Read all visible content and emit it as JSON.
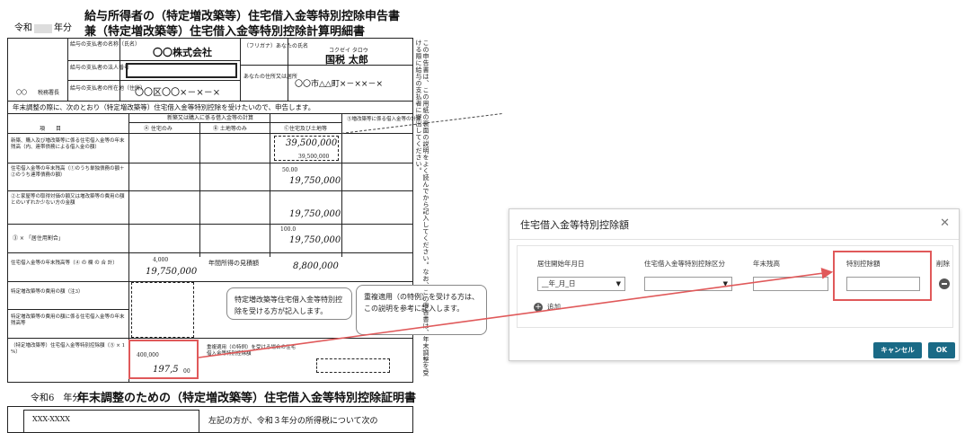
{
  "form": {
    "era_label": "令和",
    "era_suffix": "年分",
    "title1": "給与所得者の（特定増改築等）住宅借入金等特別控除申告書",
    "title2": "兼（特定増改築等）住宅借入金等特別控除計算明細書",
    "payer_name_label": "給与の支払者の名称（氏名）",
    "payer_name_value": "〇〇株式会社",
    "corp_number_label": "給与の支払者の法人番号",
    "payer_address_label": "給与の支払者の所在地（住所）",
    "payer_address_value": "〇〇区〇〇×－×－×",
    "tax_office": "〇〇　　税務署長",
    "furigana_label": "（フリガナ）あなたの氏名",
    "name_furigana": "コクゼイ タロウ",
    "name_value": "国税 太郎",
    "your_address_label": "あなたの住所又は居所",
    "your_address_value": "〇〇市△△町×－××－×",
    "intro": "年末調整の際に、次のとおり（特定増改築等）住宅借入金等特別控除を受けたいので、申告します。",
    "col_new_build": "新築又は購入に係る借入金等の計算",
    "col_house": "Ⓐ 住宅のみ",
    "col_land": "Ⓑ 土地等のみ",
    "col_both": "Ⓒ住宅及び土地等",
    "col_remodel": "⑤増改築等に係る借入金等の計算",
    "col_item": "項　　目",
    "row1_label": "新築、購入及び増改築等に係る住宅借入金等の年末残高（内、連帯債務による借入金の額）",
    "row1_value": "39,500,000",
    "row1_sub": "39,500,000",
    "row2_label": "住宅借入金等の年末残高（①のうち単独債務の額＋②のうち連帯債務の額）",
    "row2_pct": "50.00",
    "row2_value": "19,750,000",
    "row3_label": "②と家屋等の取得対価の額又は増改築等の費用の額とのいずれか少ない方の金額",
    "row3_value": "19,750,000",
    "row4_label": "③ × 「居住用割合」",
    "row4_pct": "100.0",
    "row4_value": "19,750,000",
    "row5_label": "住宅借入金等の年末残高等（④ の 欄 の 合 計）",
    "row5_max": "4,000",
    "row5_value": "19,750,000",
    "income_label": "年間所得の見積額",
    "income_value": "8,800,000",
    "row6_label": "特定増改築等の費用の額（注3）",
    "row7_label": "特定増改築等の費用の額に係る住宅借入金等の年末残高等",
    "row8_label": "（特定増改築等）住宅借入金等特別控除額（⑤ × 1 %）",
    "row8_max": "400,000",
    "row8_value": "197,5",
    "row8_yen": "00",
    "dup_label": "重複適用（の特例）を受ける場合の住宅借入金等特別控除額",
    "side_text": "この申告書は、この用紙の裏面の説明をよく読んでから記入してください。なお、この申告書は、年末調整を受ける際に給与の支払者に提出してください。",
    "callout1": "特定増改築等住宅借入金等特別控除を受ける方が記入します。",
    "callout2": "重複適用（の特例）を受ける方は、この説明を参考に記入します。",
    "cert_era": "令和6　年分",
    "cert_title": "年末調整のための（特定増改築等）住宅借入金等特別控除証明書",
    "cert_text": "左記の方が、令和３年分の所得税について次の",
    "cert_id": "XXX-XXXX"
  },
  "dialog": {
    "title": "住宅借入金等特別控除額",
    "close_icon": "close-icon",
    "columns": [
      "居住開始年月日",
      "住宅借入金等特別控除区分",
      "年末残高",
      "特別控除額",
      "削除"
    ],
    "date_placeholder": "__年_月_日",
    "category_value": "",
    "balance_value": "",
    "deduction_value": "",
    "add_label": "追加",
    "cancel_label": "キャンセル",
    "ok_label": "OK"
  },
  "colors": {
    "accent": "#1a6a86",
    "highlight": "#e0595a"
  }
}
